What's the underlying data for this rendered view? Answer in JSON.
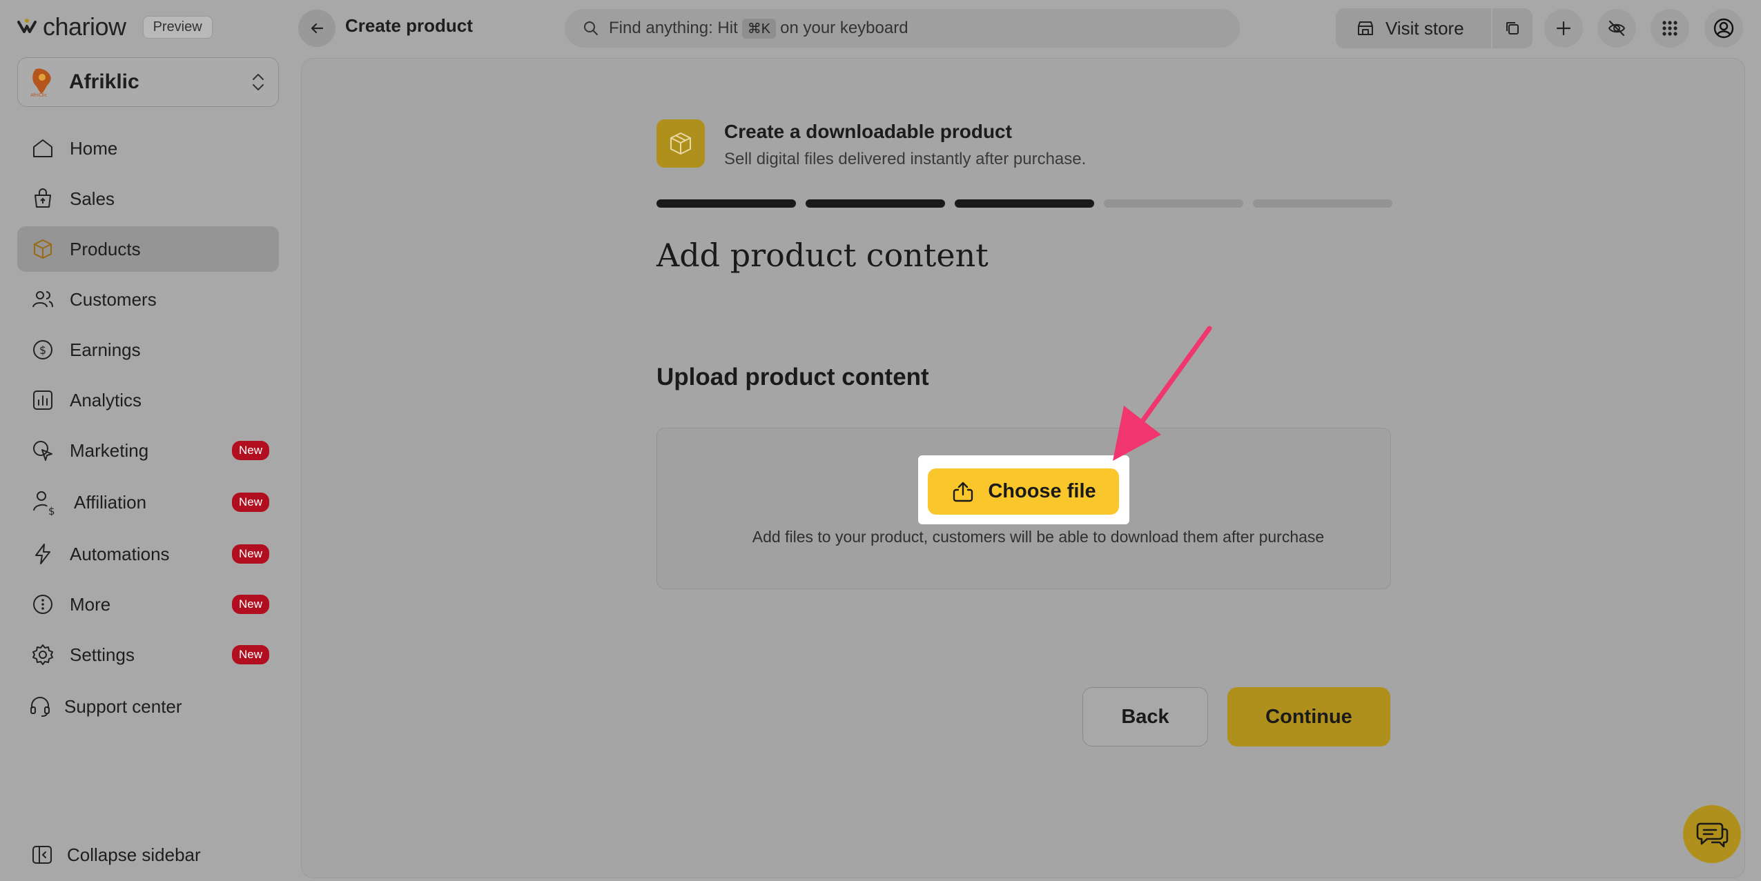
{
  "app": {
    "brand": "chariow",
    "badge": "Preview",
    "page_title": "Create product"
  },
  "search": {
    "prefix": "Find anything: Hit",
    "shortcut": "⌘K",
    "suffix": "on your keyboard"
  },
  "header_actions": {
    "visit_store": "Visit store",
    "icons": [
      "copy-icon",
      "plus-icon",
      "eye-off-icon",
      "grid-icon",
      "account-icon"
    ]
  },
  "sidebar": {
    "store_name": "Afriklic",
    "items": [
      {
        "label": "Home",
        "icon": "home-icon",
        "badge": ""
      },
      {
        "label": "Sales",
        "icon": "sales-icon",
        "badge": ""
      },
      {
        "label": "Products",
        "icon": "box-icon",
        "badge": "",
        "active": true
      },
      {
        "label": "Customers",
        "icon": "users-icon",
        "badge": ""
      },
      {
        "label": "Earnings",
        "icon": "earnings-icon",
        "badge": ""
      },
      {
        "label": "Analytics",
        "icon": "analytics-icon",
        "badge": ""
      },
      {
        "label": "Marketing",
        "icon": "marketing-icon",
        "badge": "New"
      },
      {
        "label": "Affiliation",
        "icon": "affiliation-icon",
        "badge": "New"
      },
      {
        "label": "Automations",
        "icon": "bolt-icon",
        "badge": "New"
      },
      {
        "label": "More",
        "icon": "more-icon",
        "badge": "New"
      },
      {
        "label": "Settings",
        "icon": "gear-icon",
        "badge": "New"
      },
      {
        "label": "Support center",
        "icon": "headset-icon",
        "badge": ""
      }
    ],
    "collapse_label": "Collapse sidebar"
  },
  "main": {
    "product_type_title": "Create a downloadable product",
    "product_type_subtitle": "Sell digital files delivered instantly after purchase.",
    "progress": {
      "completed_steps": 3,
      "total_steps": 5
    },
    "heading": "Add product content",
    "upload_heading": "Upload product content",
    "choose_file_label": "Choose file",
    "drop_hint": "Add files to your product, customers will be able to download them after purchase",
    "back_label": "Back",
    "continue_label": "Continue"
  },
  "colors": {
    "accent": "#f9c62b",
    "accent_dimmed": "#b0901d",
    "badge_red": "#b10f1f",
    "annotation_arrow": "#f0356f"
  }
}
